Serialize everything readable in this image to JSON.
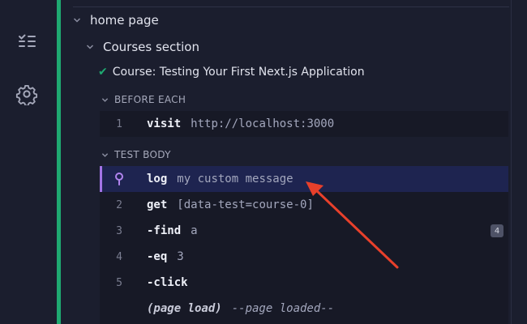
{
  "rail": {
    "icons": [
      "specs-list-icon",
      "settings-gear-icon"
    ]
  },
  "tree": {
    "suite": "home page",
    "section": "Courses section",
    "test": "Course: Testing Your First Next.js Application"
  },
  "hooks": {
    "before_each": {
      "label": "BEFORE EACH",
      "commands": [
        {
          "num": "1",
          "name": "visit",
          "arg": "http://localhost:3000"
        }
      ]
    },
    "test_body": {
      "label": "TEST BODY",
      "commands": [
        {
          "num": "",
          "name": "log",
          "arg": "my custom message"
        },
        {
          "num": "2",
          "name": "get",
          "arg": "[data-test=course-0]"
        },
        {
          "num": "3",
          "name": "-find",
          "arg": "a",
          "badge": "4"
        },
        {
          "num": "4",
          "name": "-eq",
          "arg": "3"
        },
        {
          "num": "5",
          "name": "-click",
          "arg": ""
        }
      ],
      "page_load": {
        "event": "(page load)",
        "message": "--page loaded--"
      }
    }
  },
  "colors": {
    "pass": "#1fa971",
    "selected_bg": "#1e2450",
    "selected_accent": "#a374e6",
    "arrow": "#e8402b"
  }
}
